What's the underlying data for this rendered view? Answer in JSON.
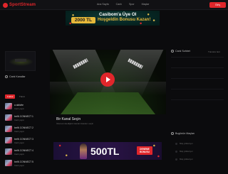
{
  "app": {
    "name": "SportStream"
  },
  "nav": {
    "items": [
      "Ana Sayfa",
      "Canlı",
      "Spor",
      "Maçlar"
    ]
  },
  "header": {
    "login_label": "Giriş"
  },
  "top_banner": {
    "title": "Casibom'a Üye Ol",
    "amount": "2000 TL",
    "subtitle": "Hoşgeldin Bonusu Kazan!"
  },
  "left": {
    "section_title": "Canlı Kanallar",
    "tabs": [
      "Futbol",
      "Tümü"
    ],
    "items": [
      {
        "title": "a aktivite",
        "sub": "Canlı yayın"
      },
      {
        "title": "beIN CONNECT 1",
        "sub": "Canlı yayın"
      },
      {
        "title": "beIN CONNECT 2",
        "sub": "Canlı yayın"
      },
      {
        "title": "beIN CONNECT 3",
        "sub": "Canlı yayın"
      },
      {
        "title": "beIN CONNECT 4",
        "sub": "Canlı yayın"
      },
      {
        "title": "beIN CONNECT 5",
        "sub": "Canlı yayın"
      }
    ]
  },
  "player": {
    "title": "Bir Kanal Seçin",
    "subtitle": "İzlemek istediğiniz kanalı listeden seçin"
  },
  "bottom_banner": {
    "amount": "500TL",
    "badge_line1": "DENEME",
    "badge_line2": "BONUSU"
  },
  "right": {
    "section_title": "Canlı Sohbet",
    "link": "Tümünü Gör",
    "section2_title": "Bugünün Maçları",
    "rows": [
      "Maç yükleniyor",
      "Maç yükleniyor",
      "Maç yükleniyor"
    ]
  },
  "colors": {
    "accent": "#e0262b",
    "background": "#0b0b0d",
    "gold": "#e6b83a"
  },
  "icons": {
    "logo": "play-circle-icon",
    "section": "radio-icon"
  }
}
